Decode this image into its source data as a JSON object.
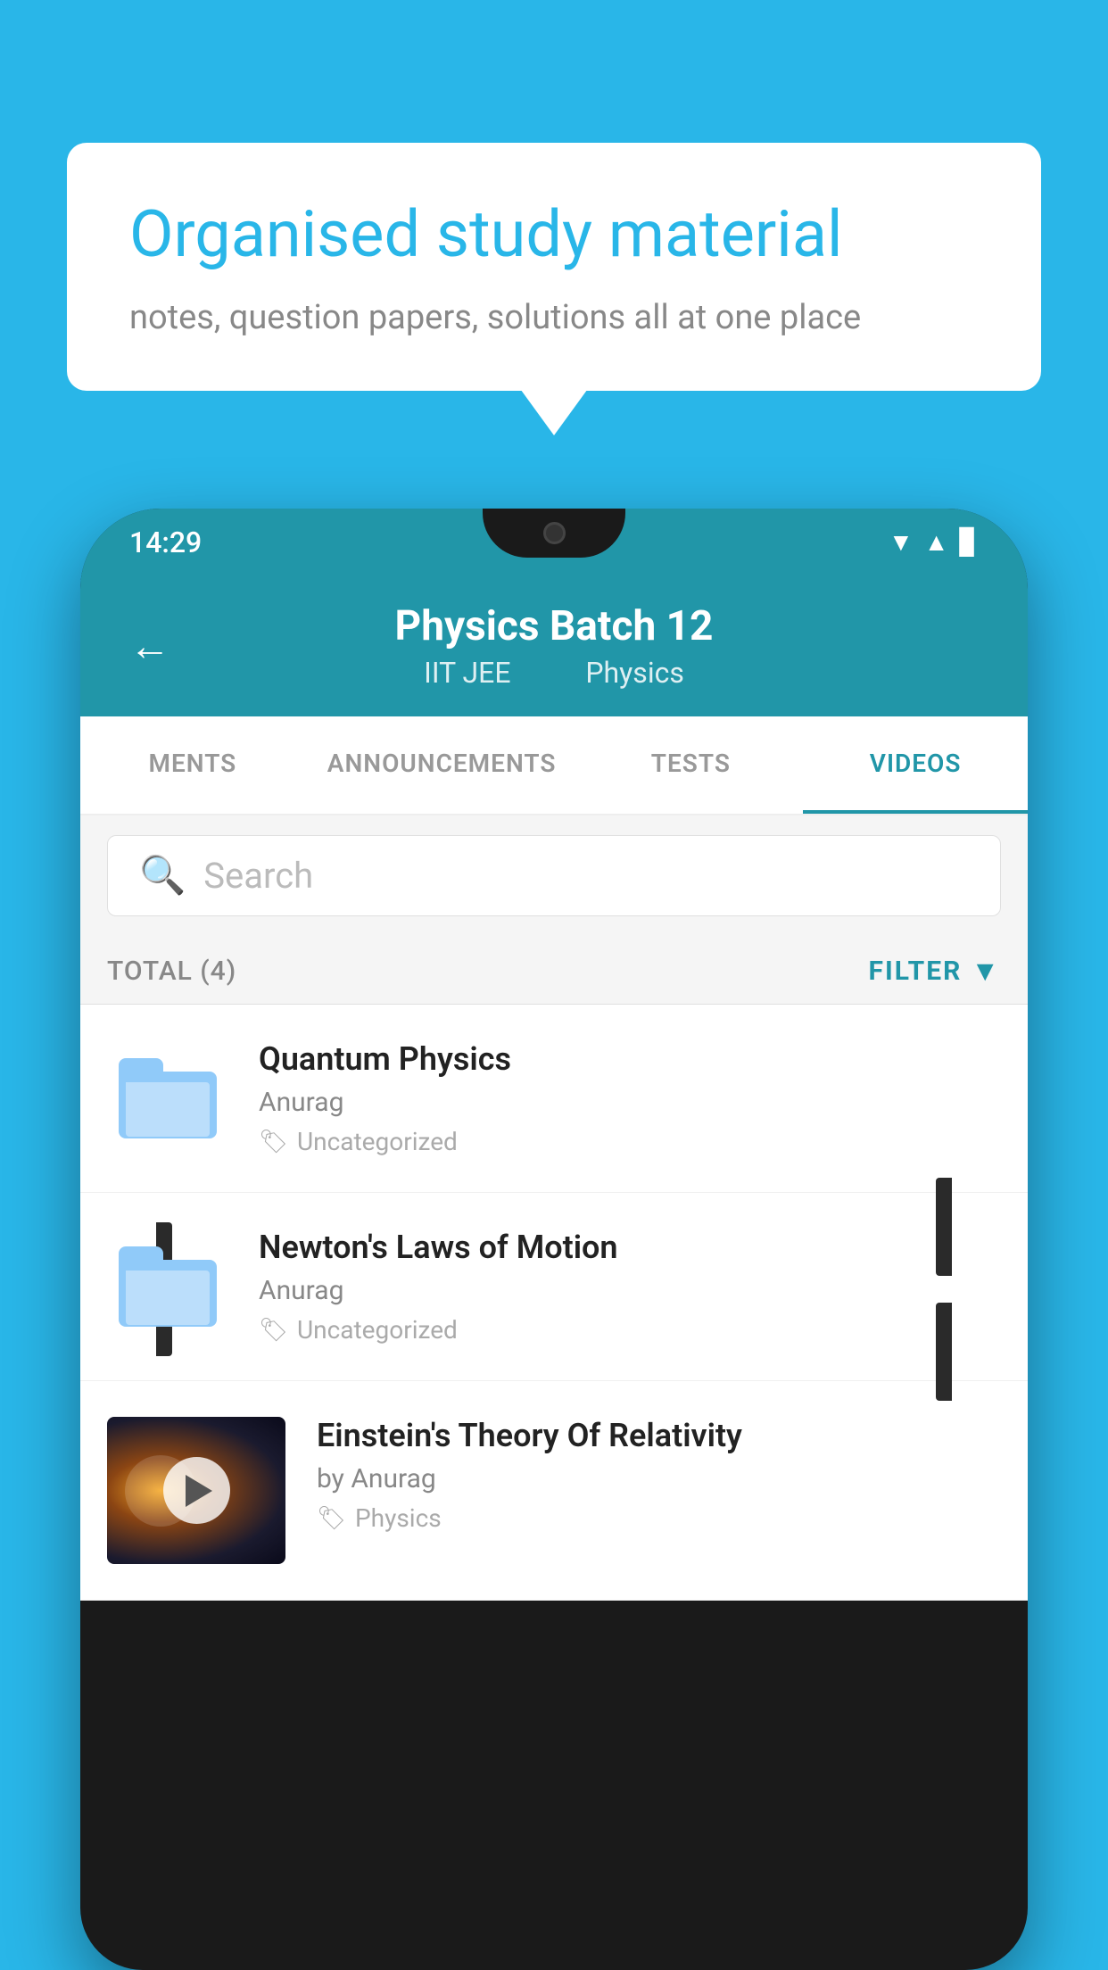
{
  "background": {
    "color": "#29b6e8"
  },
  "speech_bubble": {
    "headline": "Organised study material",
    "subtext": "notes, question papers, solutions all at one place"
  },
  "phone": {
    "status_bar": {
      "time": "14:29"
    },
    "app_header": {
      "back_label": "←",
      "title": "Physics Batch 12",
      "subtitle_part1": "IIT JEE",
      "subtitle_part2": "Physics"
    },
    "tabs": [
      {
        "label": "MENTS",
        "active": false
      },
      {
        "label": "ANNOUNCEMENTS",
        "active": false
      },
      {
        "label": "TESTS",
        "active": false
      },
      {
        "label": "VIDEOS",
        "active": true
      }
    ],
    "search": {
      "placeholder": "Search"
    },
    "filter_row": {
      "total_label": "TOTAL (4)",
      "filter_label": "FILTER"
    },
    "videos": [
      {
        "id": 1,
        "title": "Quantum Physics",
        "author": "Anurag",
        "tag": "Uncategorized",
        "has_thumb": false
      },
      {
        "id": 2,
        "title": "Newton's Laws of Motion",
        "author": "Anurag",
        "tag": "Uncategorized",
        "has_thumb": false
      },
      {
        "id": 3,
        "title": "Einstein's Theory Of Relativity",
        "author": "by Anurag",
        "tag": "Physics",
        "has_thumb": true
      }
    ]
  }
}
